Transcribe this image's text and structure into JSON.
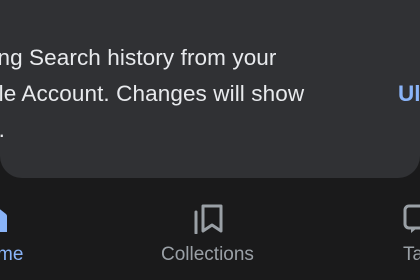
{
  "snackbar": {
    "line1": "ting Search history from your",
    "line2": "gle Account. Changes will show",
    "line3": "n.",
    "action_label": "Ul"
  },
  "bottom_nav": {
    "items": [
      {
        "label": "me",
        "icon": "home-icon",
        "active": true
      },
      {
        "label": "Collections",
        "icon": "collections-icon",
        "active": false
      },
      {
        "label": "Ta",
        "icon": "tabs-icon",
        "active": false
      }
    ],
    "active_color": "#8ab4f8",
    "inactive_color": "#9aa0a6"
  },
  "colors": {
    "background": "#1a1a1b",
    "card": "#303134",
    "text": "#e8eaed",
    "accent": "#8ab4f8"
  }
}
